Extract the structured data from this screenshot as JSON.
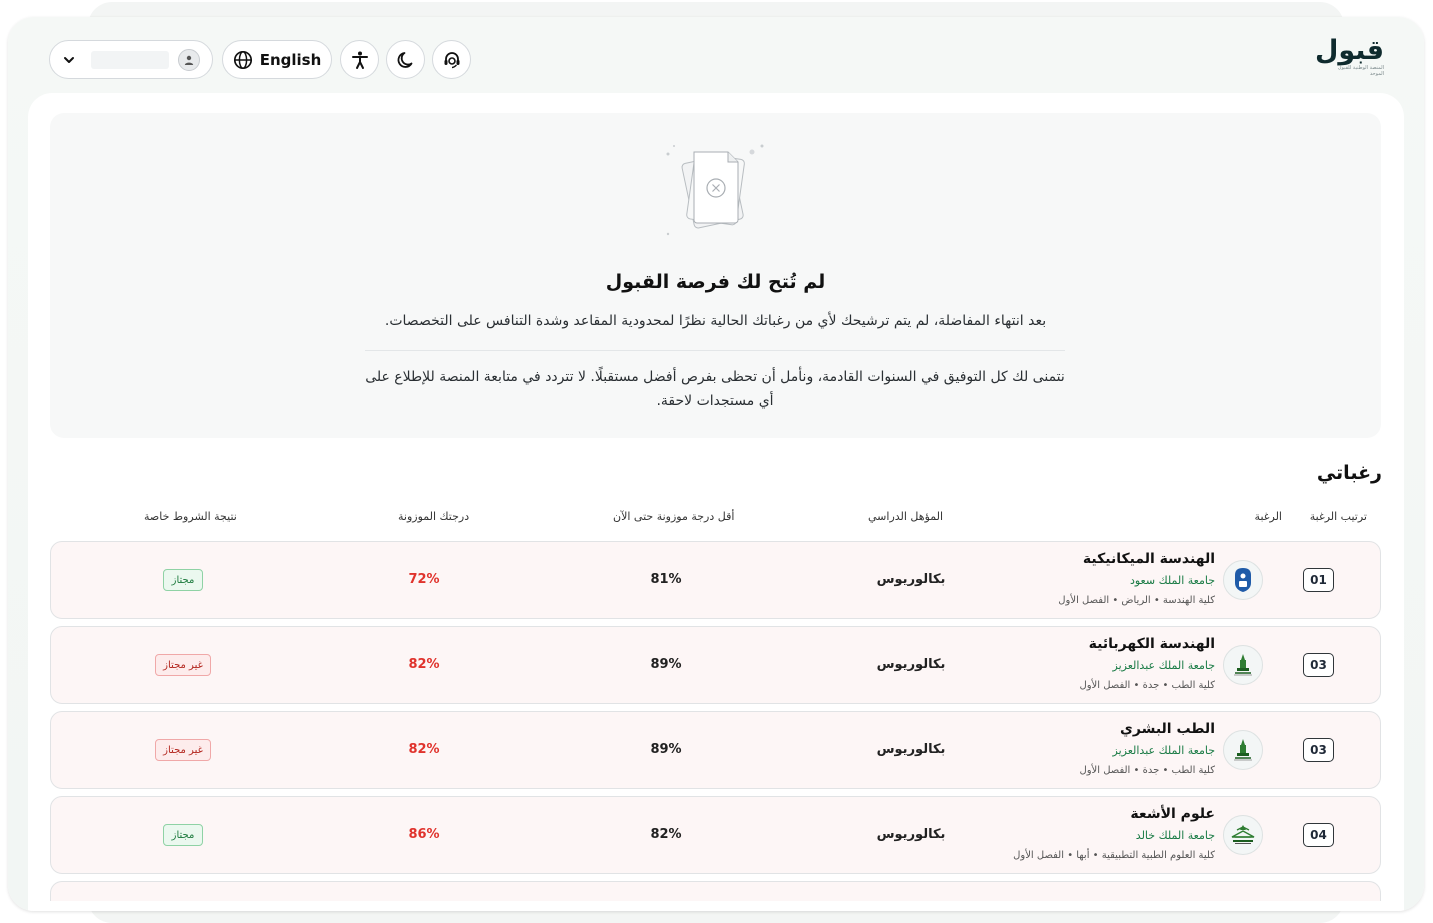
{
  "header": {
    "logo_text": "قبول",
    "logo_subtitle": "المنصة الوطنية للقبول الموحد",
    "language_label": "English",
    "user_name": ""
  },
  "notice": {
    "title": "لم تُتح لك فرصة القبول",
    "description": "بعد انتهاء المفاضلة، لم يتم ترشيحك لأي من رغباتك الحالية نظرًا لمحدودية المقاعد وشدة التنافس على التخصصات.",
    "wish": "نتمنى لك كل التوفيق في السنوات القادمة، ونأمل أن تحظى بفرص أفضل مستقبلًا. لا تتردد في متابعة المنصة للإطلاع على أي مستجدات لاحقة."
  },
  "section_title": "رغباتي",
  "table": {
    "headers": {
      "order": "ترتيب الرغبة",
      "wish": "الرغبة",
      "degree": "المؤهل الدراسي",
      "min_score": "أقل درجة موزونة حتى الآن",
      "my_score": "درجتك الموزونة",
      "special": "نتيجة الشروط خاصة"
    },
    "rows": [
      {
        "order": "01",
        "major": "الهندسة الميكانيكية",
        "university": "جامعة الملك سعود",
        "college": "كلية الهندسة • الرياض • الفصل الأول",
        "degree": "بكالوريوس",
        "min_score": "81%",
        "my_score": "72%",
        "special": "مجتاز",
        "special_status": "passed",
        "logo_icon": "ksu-logo-icon"
      },
      {
        "order": "03",
        "major": "الهندسة الكهربائية",
        "university": "جامعة الملك عبدالعزيز",
        "college": "كلية الطب • جدة • الفصل الأول",
        "degree": "بكالوريوس",
        "min_score": "89%",
        "my_score": "82%",
        "special": "غير مجتاز",
        "special_status": "failed",
        "logo_icon": "kau-logo-icon"
      },
      {
        "order": "03",
        "major": "الطب البشري",
        "university": "جامعة الملك عبدالعزيز",
        "college": "كلية الطب • جدة • الفصل الأول",
        "degree": "بكالوريوس",
        "min_score": "89%",
        "my_score": "82%",
        "special": "غير مجتاز",
        "special_status": "failed",
        "logo_icon": "kau-logo-icon"
      },
      {
        "order": "04",
        "major": "علوم الأشعة",
        "university": "جامعة الملك خالد",
        "college": "كلية العلوم الطبية التطبيقية • أبها • الفصل الأول",
        "degree": "بكالوريوس",
        "min_score": "82%",
        "my_score": "86%",
        "special": "مجتاز",
        "special_status": "passed",
        "logo_icon": "kku-logo-icon"
      }
    ]
  },
  "colors": {
    "accent_green": "#187a44",
    "score_red": "#e0332d",
    "row_bg": "#fdf6f6"
  }
}
